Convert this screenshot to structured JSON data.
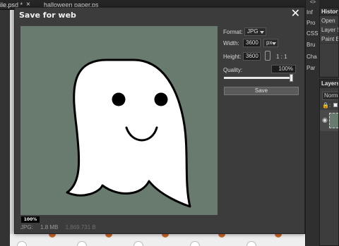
{
  "tabs": [
    {
      "label": "ile.psd *"
    },
    {
      "label": "halloween paper.ps"
    }
  ],
  "dialog": {
    "title": "Save for web",
    "zoom": "100%",
    "status": {
      "format": "JPG:",
      "size": "1.8 MB",
      "original": "1,869.731 B"
    }
  },
  "form": {
    "format_label": "Format:",
    "format_value": "JPG",
    "width_label": "Width:",
    "width_value": "3600",
    "unit_value": "px",
    "height_label": "Height:",
    "height_value": "3600",
    "ratio": "1 : 1",
    "quality_label": "Quality:",
    "quality_value": "100%",
    "quality_fraction": 1.0,
    "save_label": "Save"
  },
  "side_strip": {
    "top": "<>",
    "items": [
      "Inf",
      "Pro",
      "CSS",
      "Bru",
      "Cha",
      "Par"
    ]
  },
  "history": {
    "title": "History",
    "items": [
      "Open",
      "Layer St",
      "Paint Bu"
    ]
  },
  "layers": {
    "title": "Layers",
    "blend_mode": "Norma",
    "lock_label": ":"
  },
  "colors": {
    "preview_bg": "#697a6e",
    "dialog_bg": "#3c3c3c",
    "ghost_fill": "#ffffff"
  }
}
